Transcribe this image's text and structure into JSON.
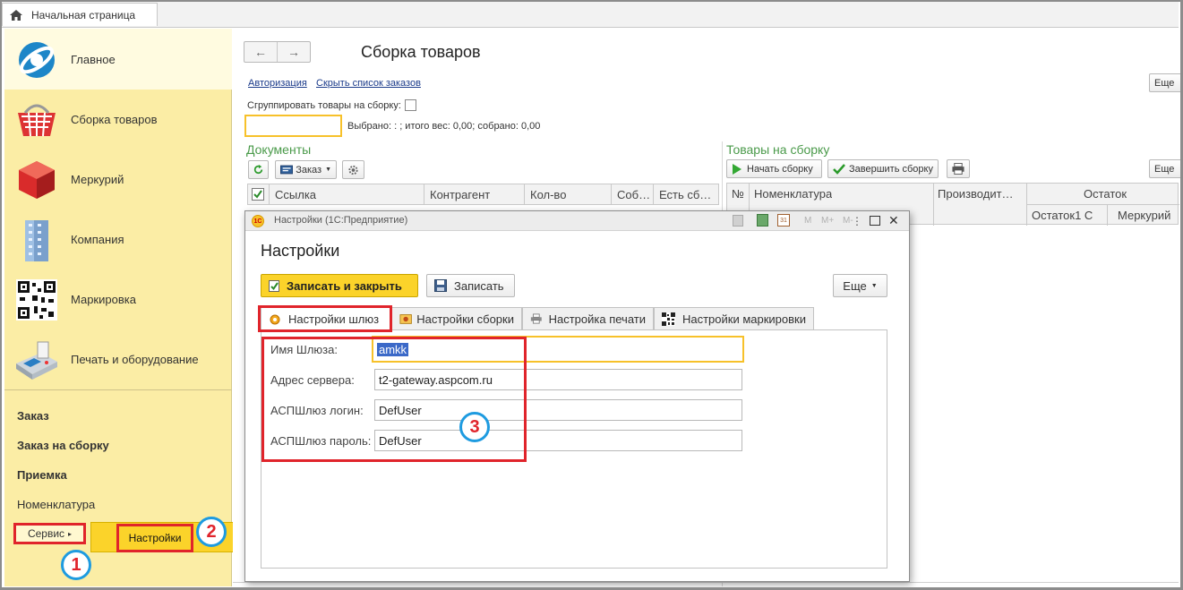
{
  "home_tab": {
    "label": "Начальная страница"
  },
  "sidebar": {
    "sections": [
      {
        "label": "Главное",
        "icon": "globe-icon"
      },
      {
        "label": "Сборка товаров",
        "icon": "basket-icon"
      },
      {
        "label": "Меркурий",
        "icon": "cube-icon"
      },
      {
        "label": "Компания",
        "icon": "building-icon"
      },
      {
        "label": "Маркировка",
        "icon": "qr-code-icon"
      },
      {
        "label": "Печать и оборудование",
        "icon": "pos-terminal-icon"
      }
    ],
    "links": [
      {
        "label": "Заказ",
        "bold": true
      },
      {
        "label": "Заказ на сборку",
        "bold": true
      },
      {
        "label": "Приемка",
        "bold": true
      },
      {
        "label": "Номенклатура",
        "bold": false
      }
    ],
    "service": "Сервис",
    "service_arrow": "▸",
    "popup_item": "Настройки"
  },
  "annotations": [
    "1",
    "2",
    "3"
  ],
  "main": {
    "title": "Сборка товаров",
    "links": [
      "Авторизация",
      "Скрыть список заказов"
    ],
    "group_label": "Сгруппировать товары на сборку:",
    "selected_info": "Выбрано: : ; итого вес: 0,00; собрано: 0,00",
    "more_label": "Еще",
    "documents": {
      "title": "Документы",
      "order_button": "Заказ",
      "columns": [
        "Ссылка",
        "Контрагент",
        "Кол-во",
        "Соб…",
        "Есть сб…"
      ]
    },
    "goods": {
      "title": "Товары на сборку",
      "start_button": "Начать сборку",
      "finish_button": "Завершить сборку",
      "columns": {
        "num": "№",
        "name": "Номенклатура",
        "maker": "Производит…",
        "rest": "Остаток",
        "rest1c": "Остаток1 С",
        "mercury": "Меркурий"
      }
    }
  },
  "dialog": {
    "window_title": "Настройки (1С:Предприятие)",
    "app_badge": "1С",
    "title": "Настройки",
    "save_close": "Записать и закрыть",
    "save": "Записать",
    "more": "Еще",
    "tabs": [
      "Настройки шлюз",
      "Настройки сборки",
      "Настройка печати",
      "Настройки маркировки"
    ],
    "fields": [
      {
        "label": "Имя Шлюза:",
        "value": "amkk"
      },
      {
        "label": "Адрес сервера:",
        "value": "t2-gateway.aspcom.ru"
      },
      {
        "label": "АСПШлюз логин:",
        "value": "DefUser"
      },
      {
        "label": "АСПШлюз пароль:",
        "value": "DefUser"
      }
    ],
    "title_tools": [
      "M",
      "M+",
      "M-"
    ]
  },
  "colors": {
    "sidebar_bg": "#fbeda5",
    "accent_yellow": "#fbd32a",
    "annotation_red": "#e0242b",
    "annotation_blue": "#1e9be0",
    "section_green": "#4a9a4a"
  }
}
